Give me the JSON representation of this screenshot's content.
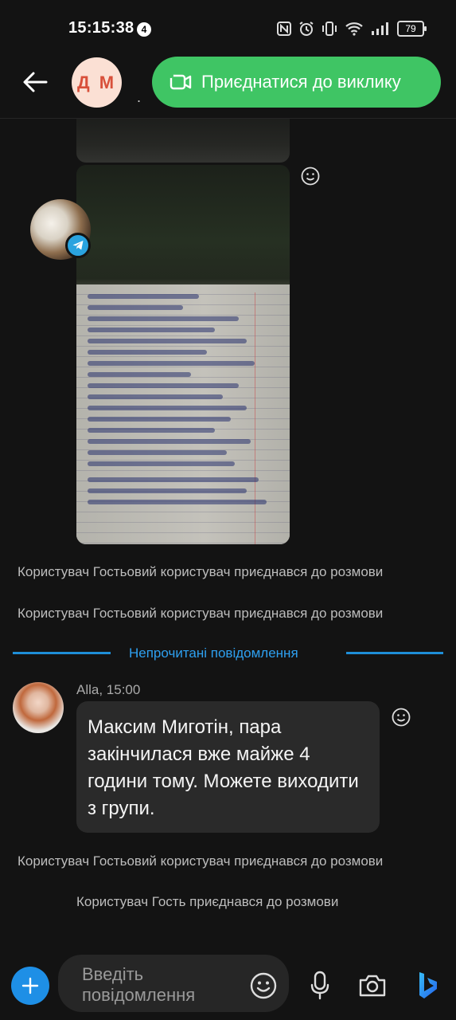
{
  "status_bar": {
    "time": "15:15:38",
    "notification_count": "4",
    "battery_level": "79"
  },
  "header": {
    "avatar_initials": "Д М",
    "separator": ".",
    "join_call_label": "Приєднатися до виклику"
  },
  "messages": {
    "system_1": "Користувач Гостьовий користувач приєднався до розмови",
    "system_2": "Користувач Гостьовий користувач приєднався до розмови",
    "unread_divider": "Непрочитані повідомлення",
    "alla_meta": "Alla, 15:00",
    "alla_text": "Максим Миготін, пара закінчилася вже майже 4 години тому. Можете виходити з групи.",
    "system_3": "Користувач Гостьовий користувач приєднався до розмови",
    "system_4": "Користувач Гость приєднався до розмови"
  },
  "composer": {
    "placeholder": "Введіть повідомлення"
  },
  "colors": {
    "background": "#131313",
    "join_button": "#3fc564",
    "accent_blue": "#1e8fe6",
    "bubble": "#2a2a2a"
  },
  "icons": [
    "back-arrow-icon",
    "video-call-icon",
    "smiley-icon",
    "telegram-icon",
    "plus-icon",
    "emoji-icon",
    "microphone-icon",
    "camera-icon",
    "bing-icon"
  ]
}
